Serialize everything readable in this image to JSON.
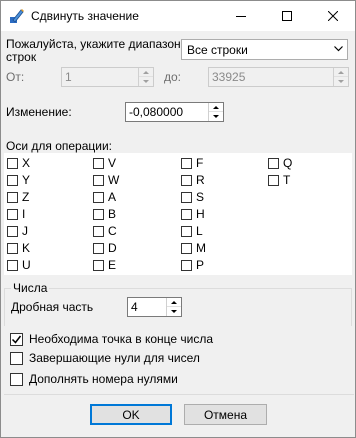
{
  "window": {
    "title": "Сдвинуть значение",
    "icon": "pencil-app-icon"
  },
  "range": {
    "label": "Пожалуйста, укажите диапазон строк",
    "label_line1": "Пожалуйста, укажите диапазон",
    "label_line2": "строк",
    "selected": "Все строки",
    "from_label": "От:",
    "from_value": "1",
    "to_label": "до:",
    "to_value": "33925",
    "enabled": false
  },
  "change": {
    "label": "Изменение:",
    "value": "-0,080000"
  },
  "axes": {
    "label": "Оси для операции:",
    "columns": [
      [
        "X",
        "Y",
        "Z",
        "I",
        "J",
        "K",
        "U"
      ],
      [
        "V",
        "W",
        "A",
        "B",
        "C",
        "D",
        "E"
      ],
      [
        "F",
        "R",
        "S",
        "H",
        "L",
        "M",
        "P"
      ],
      [
        "Q",
        "T"
      ]
    ]
  },
  "numbers": {
    "group_label": "Числа",
    "fraction_label": "Дробная часть",
    "fraction_value": "4",
    "options": [
      {
        "label": "Необходима точка в конце числа",
        "checked": true
      },
      {
        "label": "Завершающие нули для чисел",
        "checked": false
      },
      {
        "label": "Дополнять номера нулями",
        "checked": false
      }
    ]
  },
  "buttons": {
    "ok": "OK",
    "cancel": "Отмена"
  }
}
